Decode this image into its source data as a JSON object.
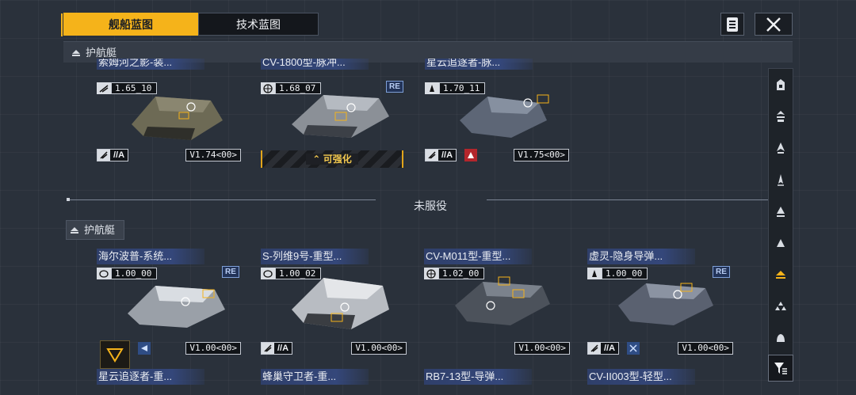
{
  "tabs": [
    {
      "label": "舰船蓝图",
      "active": true
    },
    {
      "label": "技术蓝图",
      "active": false
    }
  ],
  "section_header": {
    "label": "护航艇"
  },
  "divider_label": "未服役",
  "sub_header": {
    "label": "护航艇"
  },
  "upgrade_label": "可强化",
  "accent_color": "#f5b31a",
  "top_cards": [
    {
      "name": "索姆河之影-装...",
      "version": "1.65_10",
      "class": "//A",
      "version_box": "V1.74<00>",
      "re": false
    },
    {
      "name": "CV-1800型-脉冲...",
      "version": "1.68_07",
      "class": "",
      "version_box": "",
      "re": true
    },
    {
      "name": "星云追逐者-脉...",
      "version": "1.70_11",
      "class": "//A",
      "version_box": "V1.75<00>",
      "re": false
    }
  ],
  "cards": [
    {
      "name": "海尔波普-系统...",
      "version": "1.00_00",
      "class": "",
      "version_box": "V1.00<00>",
      "re": true
    },
    {
      "name": "S-列维9号-重型...",
      "version": "1.00_02",
      "class": "//A",
      "version_box": "V1.00<00>",
      "re": false
    },
    {
      "name": "CV-M011型-重型...",
      "version": "1.02_00",
      "class": "",
      "version_box": "V1.00<00>",
      "re": false
    },
    {
      "name": "虚灵-隐身导弹...",
      "version": "1.00_00",
      "class": "//A",
      "version_box": "V1.00<00>",
      "re": true
    }
  ],
  "bottom_cards": [
    {
      "name": "星云追逐者-重..."
    },
    {
      "name": "蜂巢守卫者-重..."
    },
    {
      "name": "RB7-13型-导弹..."
    },
    {
      "name": "CV-II003型-轻型..."
    }
  ],
  "sidebar_icons": [
    "carrier-icon",
    "destroyer-icon",
    "frigate-icon",
    "cruiser-icon",
    "battlecruiser-icon",
    "corvette-icon",
    "escort-icon",
    "fighter-group-icon",
    "aux-ship-icon"
  ]
}
